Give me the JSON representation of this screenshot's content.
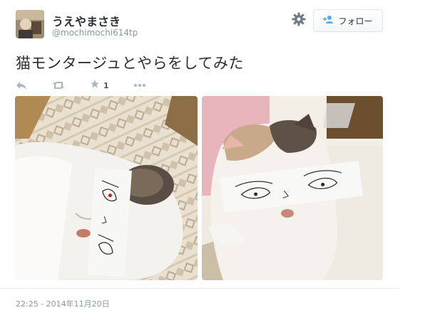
{
  "user": {
    "display_name": "うえやまさき",
    "handle": "@mochimochi614tp"
  },
  "header": {
    "settings_icon": "gear-icon",
    "follow_label": "フォロー",
    "follow_icon": "add-user-icon"
  },
  "tweet": {
    "text": "猫モンタージュとやらをしてみた",
    "favorite_count": "1",
    "timestamp": "22:25 - 2014年11月20日"
  },
  "actions": {
    "reply_icon": "reply-icon",
    "retweet_icon": "retweet-icon",
    "favorite_icon": "star-icon",
    "more_icon": "more-icon"
  },
  "colors": {
    "accent": "#55acee",
    "muted": "#8899a6",
    "text": "#292f33"
  }
}
